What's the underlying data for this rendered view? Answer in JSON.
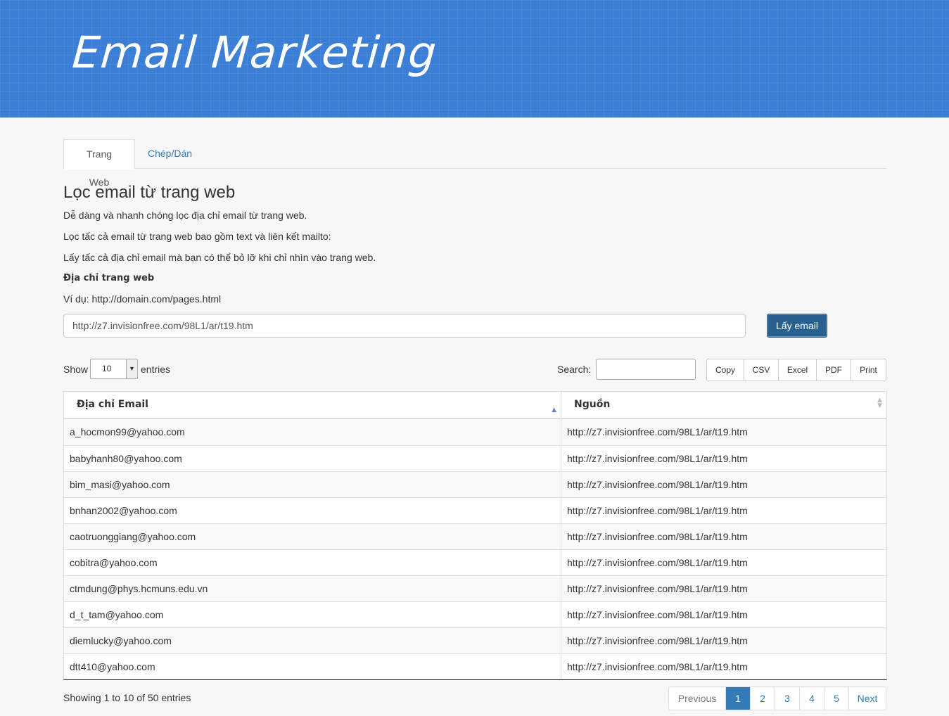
{
  "header": {
    "title": "Email Marketing"
  },
  "tabs": [
    {
      "label": "Trang Web",
      "active": true
    },
    {
      "label": "Chép/Dán",
      "active": false
    }
  ],
  "main": {
    "title": "Lọc email từ trang web",
    "paragraphs": [
      "Dễ dàng và nhanh chóng lọc địa chỉ email từ trang web.",
      "Lọc tấc cả email từ trang web bao gồm text và liên kết mailto:",
      "Lấy tấc cả địa chỉ email mà bạn có thể bỏ lỡ khi chỉ nhìn vào trang web."
    ],
    "url_label": "Địa chỉ trang web",
    "example": "Ví dụ: http://domain.com/pages.html",
    "url_value": "http://z7.invisionfree.com/98L1/ar/t19.htm",
    "get_button": "Lấy email"
  },
  "controls": {
    "show_label": "Show",
    "page_size": "10",
    "entries_label": "entries",
    "search_label": "Search:",
    "search_value": "",
    "export_buttons": [
      "Copy",
      "CSV",
      "Excel",
      "PDF",
      "Print"
    ]
  },
  "table": {
    "columns": [
      "Địa chỉ Email",
      "Nguồn"
    ],
    "rows": [
      [
        "a_hocmon99@yahoo.com",
        "http://z7.invisionfree.com/98L1/ar/t19.htm"
      ],
      [
        "babyhanh80@yahoo.com",
        "http://z7.invisionfree.com/98L1/ar/t19.htm"
      ],
      [
        "bim_masi@yahoo.com",
        "http://z7.invisionfree.com/98L1/ar/t19.htm"
      ],
      [
        "bnhan2002@yahoo.com",
        "http://z7.invisionfree.com/98L1/ar/t19.htm"
      ],
      [
        "caotruonggiang@yahoo.com",
        "http://z7.invisionfree.com/98L1/ar/t19.htm"
      ],
      [
        "cobitra@yahoo.com",
        "http://z7.invisionfree.com/98L1/ar/t19.htm"
      ],
      [
        "ctmdung@phys.hcmuns.edu.vn",
        "http://z7.invisionfree.com/98L1/ar/t19.htm"
      ],
      [
        "d_t_tam@yahoo.com",
        "http://z7.invisionfree.com/98L1/ar/t19.htm"
      ],
      [
        "diemlucky@yahoo.com",
        "http://z7.invisionfree.com/98L1/ar/t19.htm"
      ],
      [
        "dtt410@yahoo.com",
        "http://z7.invisionfree.com/98L1/ar/t19.htm"
      ]
    ]
  },
  "footer": {
    "info": "Showing 1 to 10 of 50 entries",
    "pagination": {
      "previous": "Previous",
      "pages": [
        "1",
        "2",
        "3",
        "4",
        "5"
      ],
      "current": "1",
      "next": "Next"
    }
  },
  "colors": {
    "header_bg": "#3a7fd5",
    "link": "#337ab7",
    "primary_button": "#286090"
  }
}
